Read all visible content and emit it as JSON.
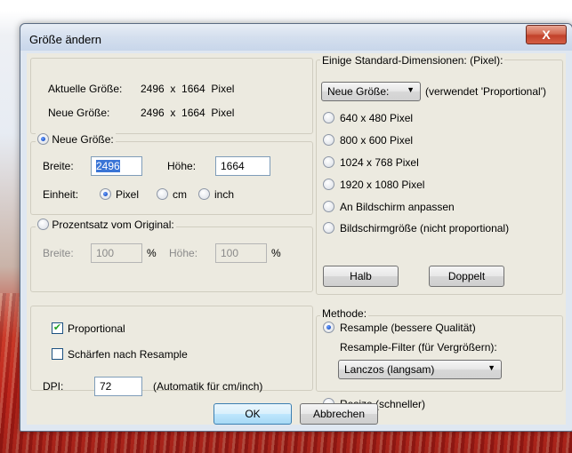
{
  "dialog": {
    "title": "Größe ändern",
    "close_label": "X"
  },
  "info": {
    "current_label": "Aktuelle Größe:",
    "current_value": "2496  x  1664  Pixel",
    "new_label": "Neue Größe:",
    "new_value": "2496  x  1664  Pixel"
  },
  "new_size": {
    "radio_label": "Neue Größe:",
    "width_label": "Breite:",
    "width_value": "2496",
    "height_label": "Höhe:",
    "height_value": "1664",
    "unit_label": "Einheit:",
    "unit_pixel": "Pixel",
    "unit_cm": "cm",
    "unit_inch": "inch"
  },
  "percent": {
    "radio_label": "Prozentsatz vom Original:",
    "width_label": "Breite:",
    "width_value": "100",
    "height_label": "Höhe:",
    "height_value": "100",
    "pct": "%"
  },
  "options": {
    "proportional_label": "Proportional",
    "proportional_checked": true,
    "sharpen_label": "Schärfen nach Resample",
    "sharpen_checked": false,
    "dpi_label": "DPI:",
    "dpi_value": "72",
    "dpi_note": "(Automatik für cm/inch)"
  },
  "standard": {
    "legend": "Einige Standard-Dimensionen: (Pixel):",
    "combo_value": "Neue Größe:",
    "combo_note": "(verwendet 'Proportional')",
    "items": [
      "640 x 480 Pixel",
      "800 x 600 Pixel",
      "1024 x 768 Pixel",
      "1920 x 1080 Pixel",
      "An Bildschirm anpassen",
      "Bildschirmgröße (nicht proportional)"
    ],
    "half_label": "Halb",
    "double_label": "Doppelt"
  },
  "method": {
    "legend": "Methode:",
    "resample_label": "Resample (bessere Qualität)",
    "filter_label": "Resample-Filter (für Vergrößern):",
    "filter_value": "Lanczos (langsam)",
    "resize_label": "Resize (schneller)"
  },
  "footer": {
    "ok_label": "OK",
    "cancel_label": "Abbrechen"
  }
}
